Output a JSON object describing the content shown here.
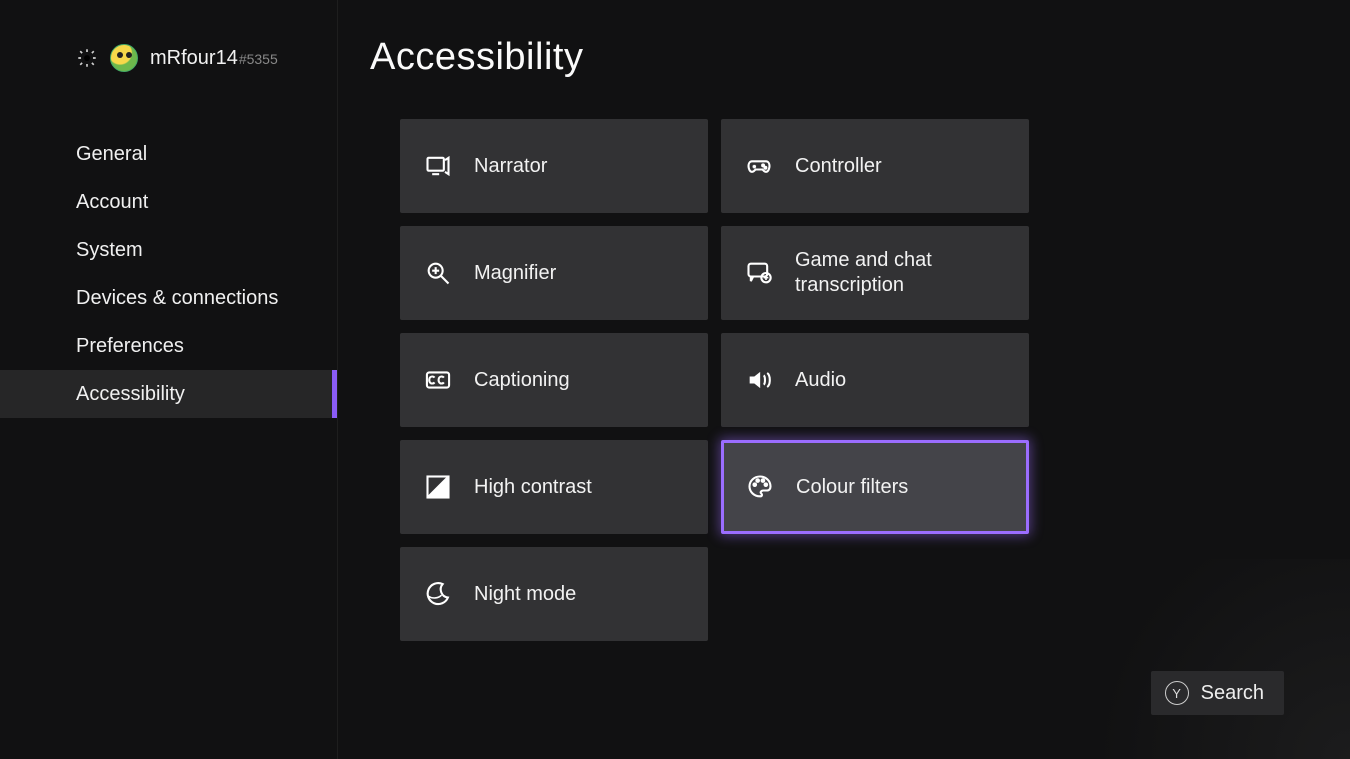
{
  "header": {
    "username": "mRfour14",
    "usertag": "#5355"
  },
  "sidebar": {
    "items": [
      {
        "label": "General"
      },
      {
        "label": "Account"
      },
      {
        "label": "System"
      },
      {
        "label": "Devices & connections"
      },
      {
        "label": "Preferences"
      },
      {
        "label": "Accessibility",
        "active": true
      }
    ]
  },
  "page": {
    "title": "Accessibility"
  },
  "tiles": [
    {
      "label": "Narrator",
      "icon": "narrator-icon"
    },
    {
      "label": "Controller",
      "icon": "controller-icon"
    },
    {
      "label": "Magnifier",
      "icon": "magnifier-icon"
    },
    {
      "label": "Game and chat transcription",
      "icon": "chat-icon"
    },
    {
      "label": "Captioning",
      "icon": "cc-icon"
    },
    {
      "label": "Audio",
      "icon": "audio-icon"
    },
    {
      "label": "High contrast",
      "icon": "contrast-icon"
    },
    {
      "label": "Colour filters",
      "icon": "palette-icon",
      "selected": true
    },
    {
      "label": "Night mode",
      "icon": "moon-icon"
    }
  ],
  "footer": {
    "search_key": "Y",
    "search_label": "Search"
  }
}
